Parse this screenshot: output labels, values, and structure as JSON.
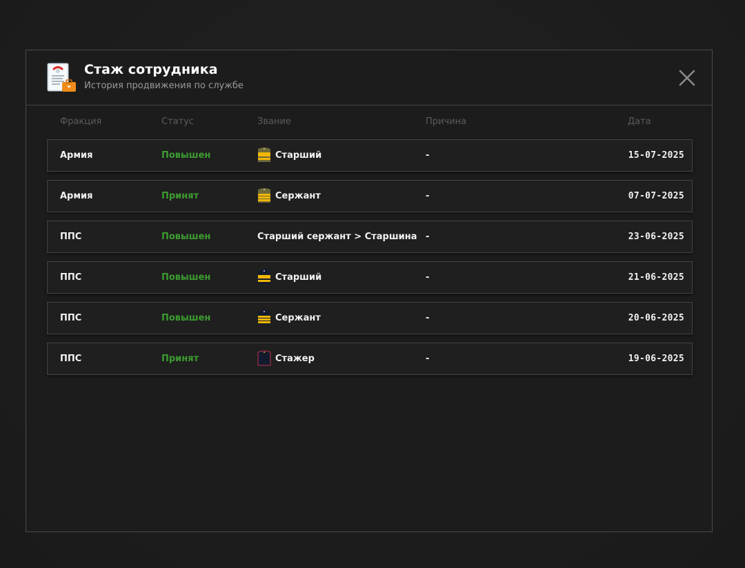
{
  "dialog": {
    "title": "Стаж сотрудника",
    "subtitle": "История продвижения по службе"
  },
  "columns": {
    "faction": "Фракция",
    "status": "Статус",
    "rank": "Звание",
    "reason": "Причина",
    "date": "Дата"
  },
  "colors": {
    "status_green": "#3c9c30",
    "army_strap": "#6e6a3a",
    "police_strap": "#141a2e",
    "stripe_gold": "#f2b705"
  },
  "rows": [
    {
      "faction": "Армия",
      "status": "Повышен",
      "rank": "Старший",
      "rank_icon": "army-senior-strap-icon",
      "reason": "-",
      "date": "15-07-2025"
    },
    {
      "faction": "Армия",
      "status": "Принят",
      "rank": "Сержант",
      "rank_icon": "army-sergeant-strap-icon",
      "reason": "-",
      "date": "07-07-2025"
    },
    {
      "faction": "ППС",
      "status": "Повышен",
      "rank": "Старший сержант > Старшина",
      "rank_icon": "",
      "reason": "-",
      "date": "23-06-2025"
    },
    {
      "faction": "ППС",
      "status": "Повышен",
      "rank": "Старший",
      "rank_icon": "police-senior-strap-icon",
      "reason": "-",
      "date": "21-06-2025"
    },
    {
      "faction": "ППС",
      "status": "Повышен",
      "rank": "Сержант",
      "rank_icon": "police-sergeant-strap-icon",
      "reason": "-",
      "date": "20-06-2025"
    },
    {
      "faction": "ППС",
      "status": "Принят",
      "rank": "Стажер",
      "rank_icon": "police-trainee-strap-icon",
      "reason": "-",
      "date": "19-06-2025"
    }
  ]
}
